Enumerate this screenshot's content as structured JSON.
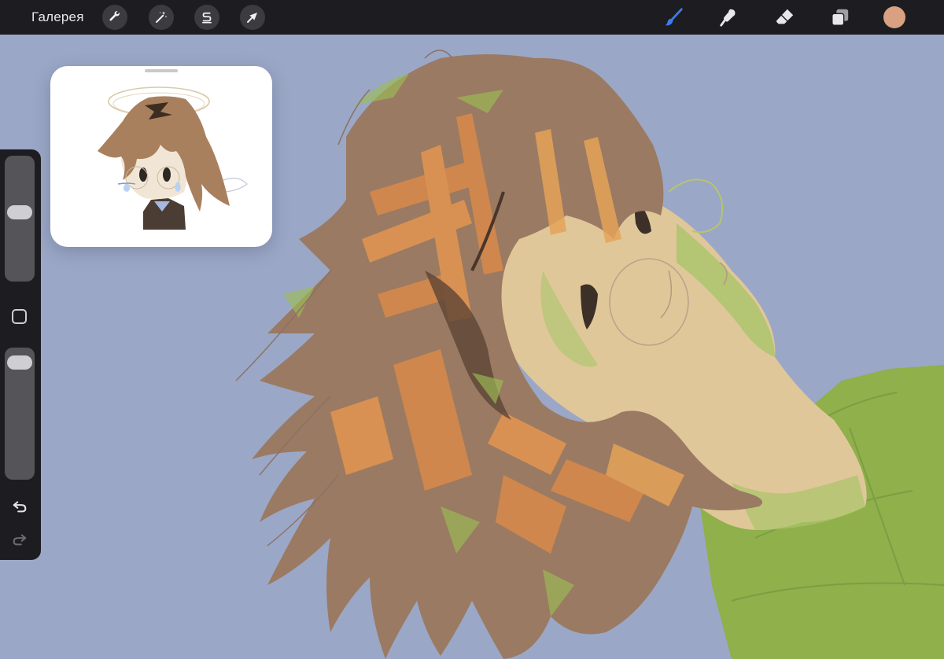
{
  "topbar": {
    "gallery_label": "Галерея",
    "left_tools": [
      "wrench-icon",
      "magic-wand-icon",
      "selection-s-icon",
      "transform-arrow-icon"
    ],
    "right_tools": [
      "brush-icon",
      "smudge-icon",
      "eraser-icon",
      "layers-icon"
    ],
    "active_tool": "brush-icon"
  },
  "colors": {
    "current_color": "#d9a181",
    "brush_active": "#3b7cf0",
    "bar_bg": "#1d1d21",
    "canvas_bg": "#9ba7c6"
  },
  "sidebar": {
    "brush_size": 0.56,
    "brush_opacity": 0.95,
    "icons": [
      "modify-square-icon",
      "undo-icon",
      "redo-icon"
    ]
  },
  "reference": {
    "visible": true
  }
}
